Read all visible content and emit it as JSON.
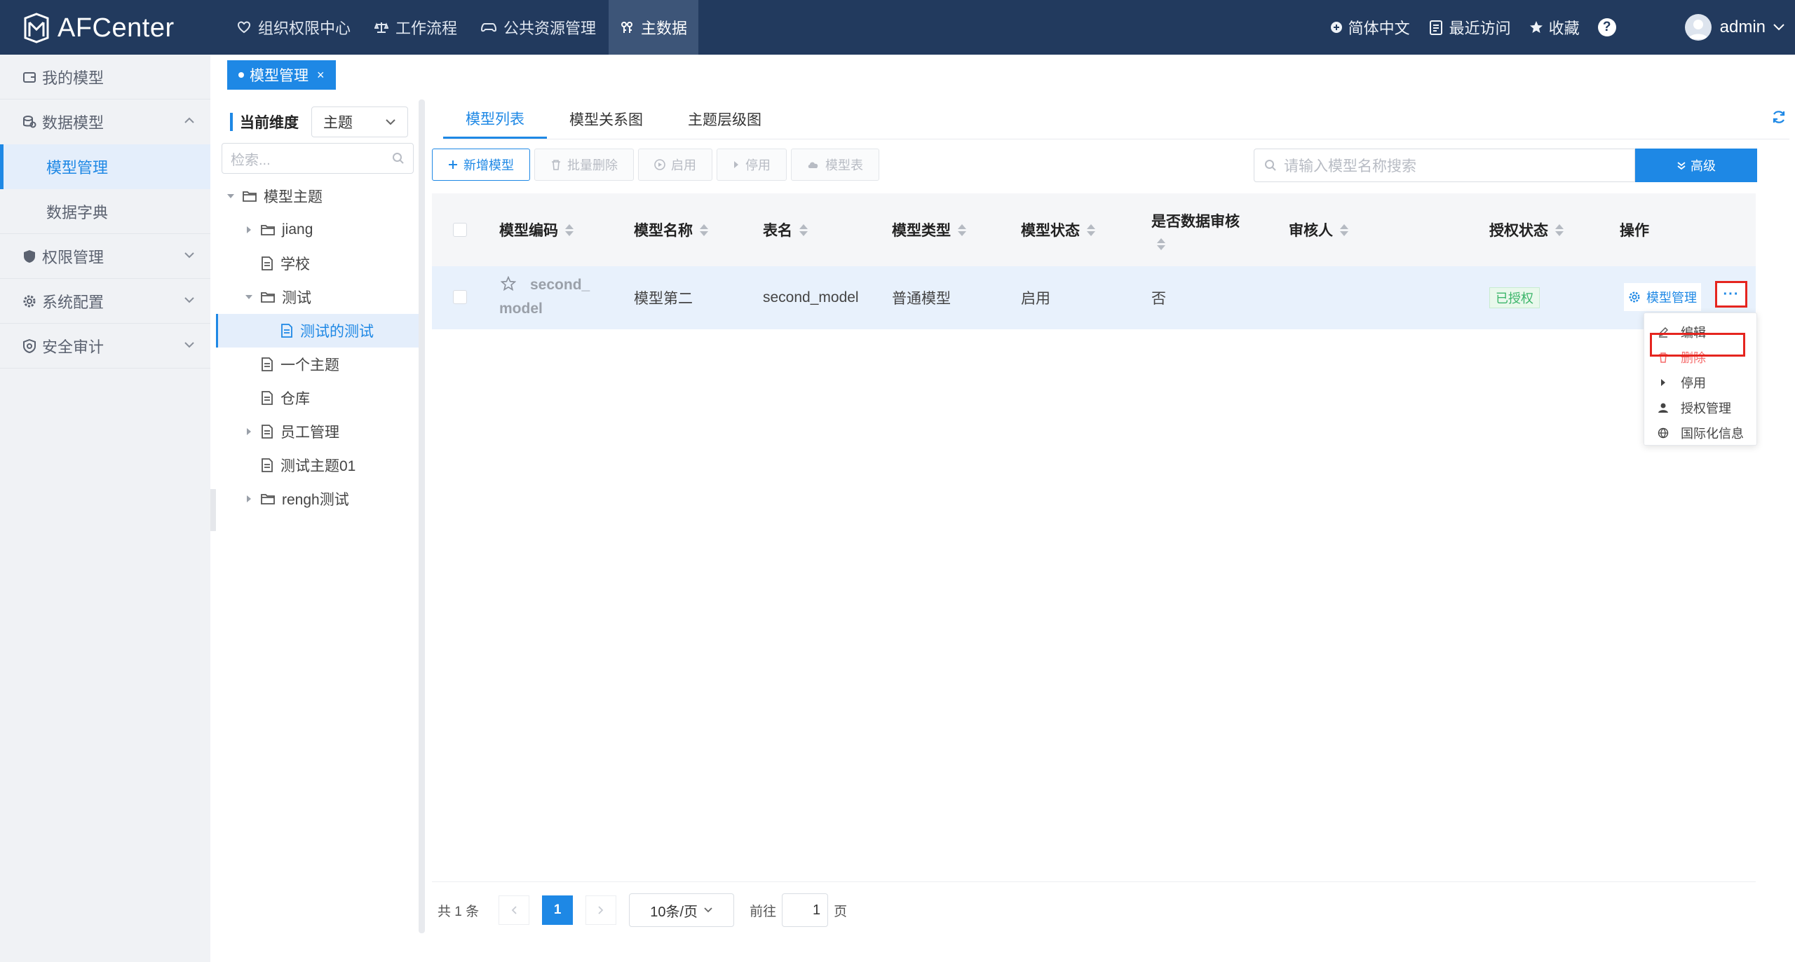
{
  "header": {
    "brand": "AFCenter",
    "nav": [
      {
        "label": "组织权限中心",
        "icon": "heart-shield-icon",
        "active": false
      },
      {
        "label": "工作流程",
        "icon": "scale-icon",
        "active": false
      },
      {
        "label": "公共资源管理",
        "icon": "gamepad-icon",
        "active": false
      },
      {
        "label": "主数据",
        "icon": "key-icon",
        "active": true
      }
    ],
    "language": "简体中文",
    "recent": "最近访问",
    "favorites": "收藏",
    "help": "?",
    "user": "admin"
  },
  "sidebar": {
    "items": [
      {
        "label": "我的模型"
      },
      {
        "label": "数据模型",
        "expanded": true,
        "children": [
          "模型管理",
          "数据字典"
        ]
      },
      {
        "label": "权限管理"
      },
      {
        "label": "系统配置"
      },
      {
        "label": "安全审计"
      }
    ]
  },
  "tagbar": {
    "tag": "模型管理",
    "close": "×"
  },
  "tree_panel": {
    "dimension_label": "当前维度",
    "dimension_value": "主题",
    "search_placeholder": "检索...",
    "nodes": [
      {
        "label": "模型主题"
      },
      {
        "label": "jiang"
      },
      {
        "label": "学校"
      },
      {
        "label": "测试"
      },
      {
        "label": "测试的测试"
      },
      {
        "label": "一个主题"
      },
      {
        "label": "仓库"
      },
      {
        "label": "员工管理"
      },
      {
        "label": "测试主题01"
      },
      {
        "label": "rengh测试"
      }
    ]
  },
  "main": {
    "tabs": [
      "模型列表",
      "模型关系图",
      "主题层级图"
    ],
    "toolbar": {
      "add": "新增模型",
      "batch_delete": "批量删除",
      "enable": "启用",
      "disable": "停用",
      "model_table": "模型表"
    },
    "search_placeholder": "请输入模型名称搜索",
    "advanced": "高级",
    "columns": [
      "模型编码",
      "模型名称",
      "表名",
      "模型类型",
      "模型状态",
      "是否数据审核",
      "审核人",
      "授权状态",
      "操作"
    ],
    "rows": [
      {
        "code": "second_model",
        "name": "模型第二",
        "table": "second_model",
        "type": "普通模型",
        "status": "启用",
        "audit": "否",
        "auditor": "",
        "auth": "已授权",
        "op": "模型管理",
        "more": "···"
      }
    ],
    "dropdown": [
      "编辑",
      "删除",
      "停用",
      "授权管理",
      "国际化信息"
    ],
    "pager": {
      "total": "共 1 条",
      "page": "1",
      "size": "10条/页",
      "goto": "前往",
      "goto_value": "1",
      "page_unit": "页"
    }
  }
}
